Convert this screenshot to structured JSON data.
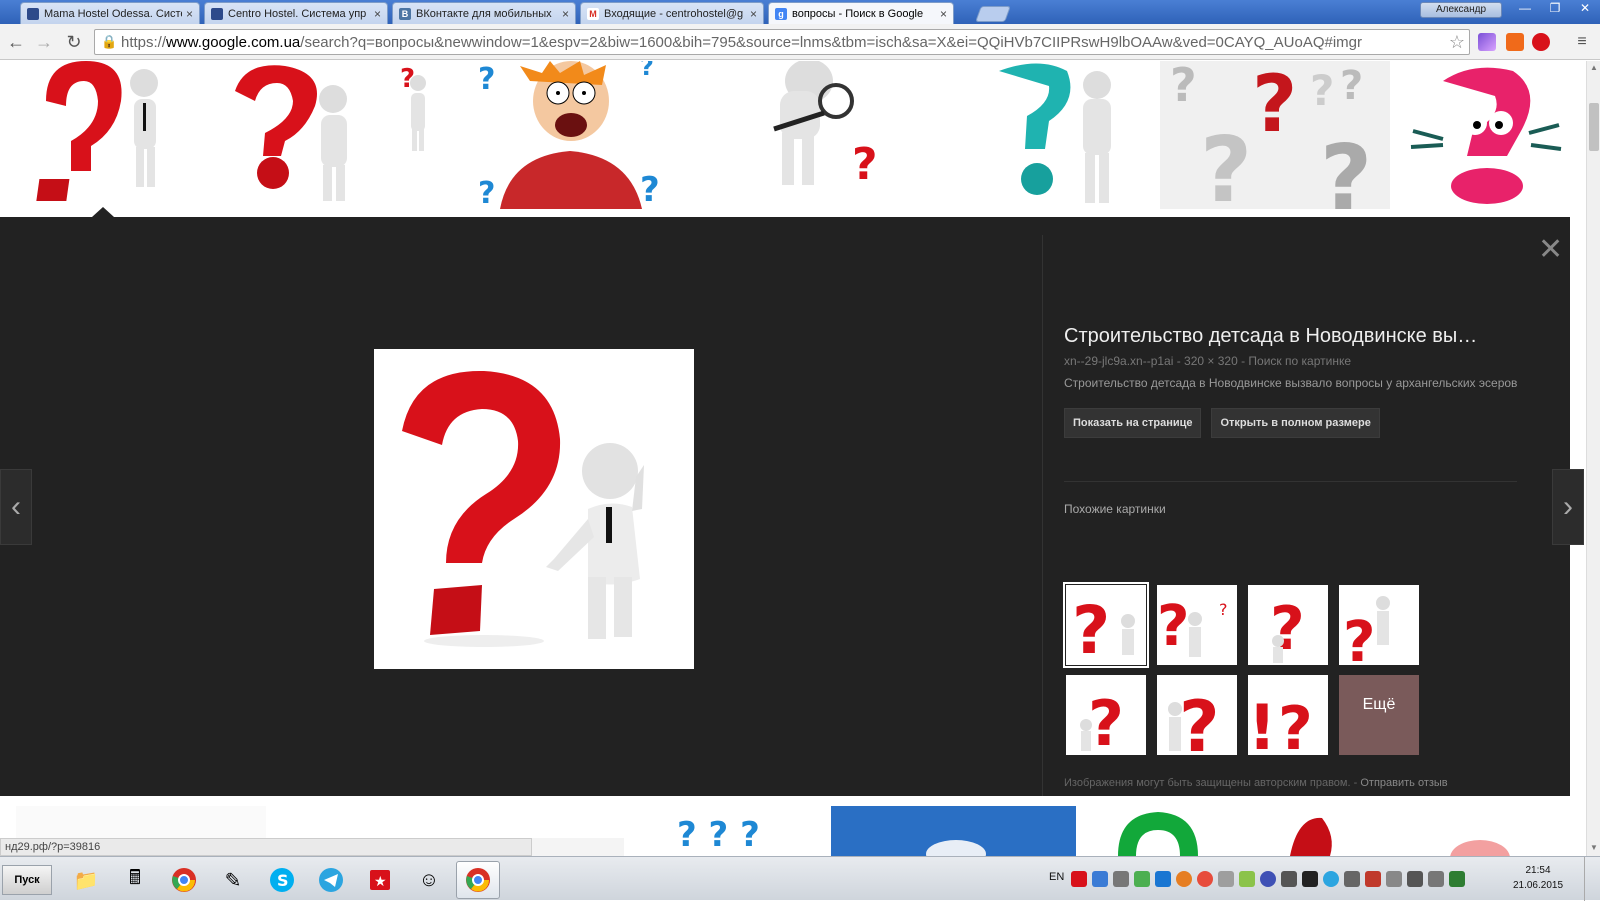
{
  "tabs": [
    {
      "title": "Mama Hostel Odessa. Систе",
      "favicon_color": "#2d4a8a"
    },
    {
      "title": "Centro Hostel. Система упр",
      "favicon_color": "#2d4a8a"
    },
    {
      "title": "ВКонтакте для мобильных",
      "favicon_color": "#4c75a3",
      "favicon_letter": "B"
    },
    {
      "title": "Входящие - centrohostel@g",
      "favicon_color": "#d93025",
      "favicon_letter": "M"
    },
    {
      "title": "вопросы - Поиск в Google",
      "favicon_color": "#4285f4",
      "favicon_letter": "g",
      "active": true
    }
  ],
  "user_name": "Александр",
  "address": {
    "scheme": "https://",
    "host": "www.google.com.ua",
    "path": "/search?q=вопросы&newwindow=1&espv=2&biw=1600&bih=795&source=lnms&tbm=isch&sa=X&ei=QQiHVb7CIIPRswH9lbOAAw&ved=0CAYQ_AUoAQ#imgr"
  },
  "preview": {
    "title": "Строительство детсада в Новодвинске вы…",
    "meta": "xn--29-jlc9a.xn--p1ai  -  320 × 320  -  Поиск по картинке",
    "description": "Строительство детсада в Новодвинске вызвало вопросы у архангельских эсеров",
    "btn_show_on_page": "Показать на странице",
    "btn_full_size": "Открыть в полном размере",
    "similar_label": "Похожие картинки",
    "more_label": "Ещё",
    "copyright_note": "Изображения могут быть защищены авторским правом.",
    "feedback_link": "Отправить отзыв"
  },
  "status_url": "нд29.рф/?p=39816",
  "taskbar": {
    "start_label": "Пуск",
    "lang": "EN",
    "time": "21:54",
    "date": "21.06.2015"
  },
  "colors": {
    "accent_red": "#d8111a",
    "panel_bg": "#222222",
    "teal": "#1fb3b0",
    "pink": "#e8226a"
  }
}
